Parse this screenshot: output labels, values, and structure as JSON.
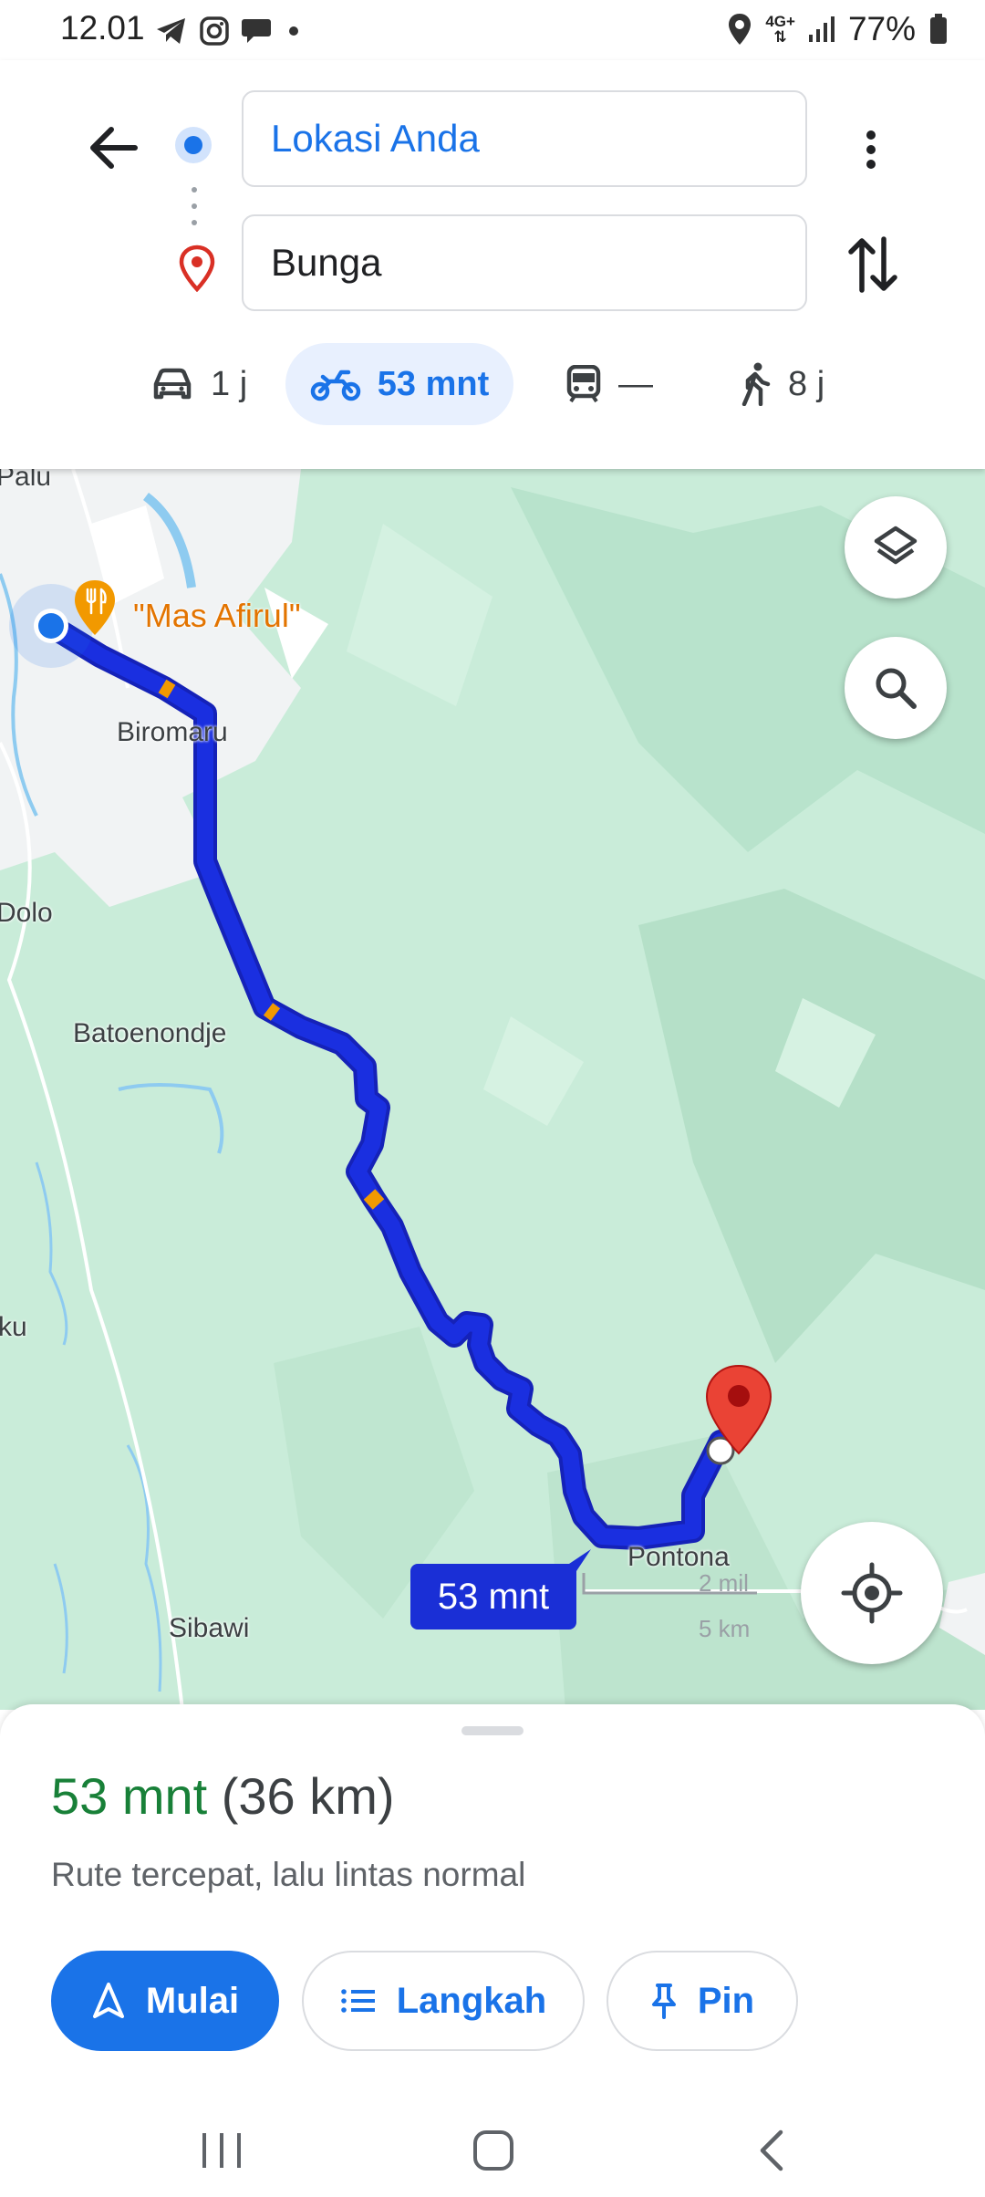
{
  "status_bar": {
    "time": "12.01",
    "network": "4G+",
    "battery": "77%"
  },
  "directions": {
    "origin": "Lokasi Anda",
    "destination": "Bunga"
  },
  "modes": [
    {
      "name": "car-icon",
      "label": "1 j",
      "selected": false
    },
    {
      "name": "motorcycle-icon",
      "label": "53 mnt",
      "selected": true
    },
    {
      "name": "transit-icon",
      "label": "—",
      "selected": false
    },
    {
      "name": "walk-icon",
      "label": "8 j",
      "selected": false
    }
  ],
  "map": {
    "labels": {
      "palu": "Palu",
      "biromaru": "Biromaru",
      "dolo": "Dolo",
      "batoenondje": "Batoenondje",
      "ku": "ku",
      "sibawi": "Sibawi",
      "pontona": "Pontona"
    },
    "poi": "\"Mas Afirul\"",
    "route_time": "53 mnt",
    "scale_mi": "2 mil",
    "scale_km": "5 km",
    "colors": {
      "route": "#1a2fd6",
      "traffic": "#f29900",
      "terrain": "#c9ecd9",
      "urban": "#f1f3f4",
      "destination_pin": "#ea4335"
    }
  },
  "summary": {
    "duration": "53 mnt",
    "distance": "(36 km)",
    "description": "Rute tercepat, lalu lintas normal"
  },
  "actions": {
    "start": "Mulai",
    "steps": "Langkah",
    "pin": "Pin"
  }
}
